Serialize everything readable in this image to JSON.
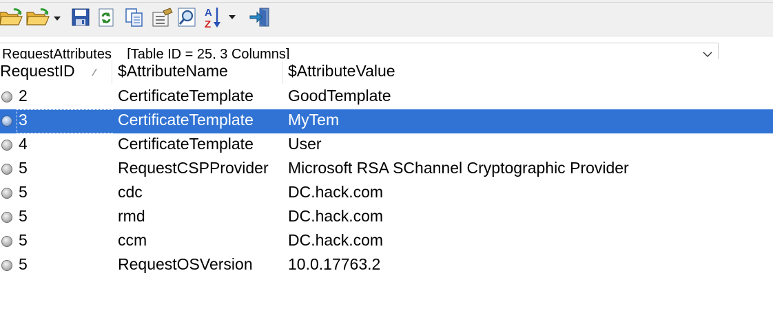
{
  "toolbar": {
    "buttons": [
      {
        "icon": "open-folder-icon"
      },
      {
        "icon": "open-folder-dropdown-icon"
      },
      {
        "icon": "save-icon"
      },
      {
        "icon": "refresh-icon"
      },
      {
        "icon": "copy-icon"
      },
      {
        "icon": "properties-icon"
      },
      {
        "icon": "find-icon"
      },
      {
        "icon": "sort-az-icon"
      },
      {
        "icon": "exit-icon"
      }
    ]
  },
  "table_selector": {
    "value": "RequestAttributes    [Table ID = 25, 3 Columns]"
  },
  "columns": [
    "RequestID",
    "$AttributeName",
    "$AttributeValue"
  ],
  "rows": [
    {
      "id": "2",
      "name": "CertificateTemplate",
      "value": "GoodTemplate",
      "selected": false
    },
    {
      "id": "3",
      "name": "CertificateTemplate",
      "value": "MyTem",
      "selected": true
    },
    {
      "id": "4",
      "name": "CertificateTemplate",
      "value": "User",
      "selected": false
    },
    {
      "id": "5",
      "name": "RequestCSPProvider",
      "value": "Microsoft RSA SChannel Cryptographic Provider",
      "selected": false
    },
    {
      "id": "5",
      "name": "cdc",
      "value": "DC.hack.com",
      "selected": false
    },
    {
      "id": "5",
      "name": "rmd",
      "value": "DC.hack.com",
      "selected": false
    },
    {
      "id": "5",
      "name": "ccm",
      "value": "DC.hack.com",
      "selected": false
    },
    {
      "id": "5",
      "name": "RequestOSVersion",
      "value": "10.0.17763.2",
      "selected": false
    }
  ],
  "colors": {
    "selection": "#3073d4",
    "toolbar_bg": "#f0f0f0"
  }
}
